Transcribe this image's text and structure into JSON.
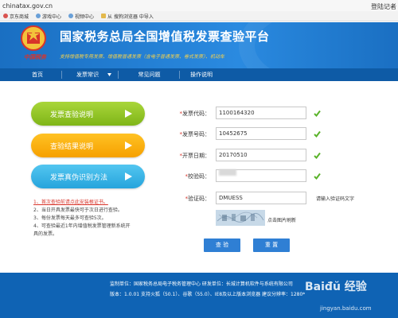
{
  "browser": {
    "url": "chinatax.gov.cn",
    "top_right": "登陆记者",
    "bookmarks": [
      "京东商城",
      "游戏中心",
      "视频中心",
      "从 搜狗浏览器 中导入"
    ]
  },
  "header": {
    "emblem_text": "中国税务",
    "title": "国家税务总局全国增值税发票查验平台",
    "subtitle": "支持增值税专用发票、增值税普通发票（含电子普通发票、卷式发票）、机动车"
  },
  "nav": {
    "items": [
      "首页",
      "发票常识",
      "常见问题",
      "操作说明"
    ]
  },
  "left_buttons": {
    "guide": "发票查验说明",
    "result": "查验结果说明",
    "identify": "发票真伪识别方法"
  },
  "notes": {
    "items": [
      "1、首次查验前请点此安装根证书。",
      "2、当日开具发票最快可于次日进行查验。",
      "3、每份发票每天最多可查验5次。",
      "4、可查验最近1年内增值税发票管理新系统开",
      "具的发票。"
    ]
  },
  "form": {
    "invoice_code_label": "发票代码：",
    "invoice_code_value": "1100164320",
    "invoice_number_label": "发票号码：",
    "invoice_number_value": "10452675",
    "issue_date_label": "开票日期：",
    "issue_date_value": "20170510",
    "check_code_label": "校验码：",
    "captcha_label": "验证码：",
    "captcha_value": "DMUESS",
    "captcha_hint": "请输入验证码文字",
    "refresh_text": "点击图片刷新",
    "submit": "查 验",
    "reset": "重 置"
  },
  "footer": {
    "line1": "监制单位：国家税务总局电子税务管理中心    研发单位：长城计算机软件与系统有限公司",
    "line2": "版本：1.0.01    支持火狐（50.1）、谷歌（55.0）、IE8及以上版本浏览器    建议分辨率：1280*"
  },
  "watermark": {
    "brand": "Baiđŭ 经验",
    "url": "jingyan.baidu.com"
  },
  "colors": {
    "banner_blue": "#1a6fc2",
    "nav_blue": "#0e5ba6",
    "green": "#8cc224",
    "orange": "#f9b20c",
    "cyan": "#3ab4e6",
    "check_green": "#5ab32a",
    "required_red": "#d8342a"
  }
}
